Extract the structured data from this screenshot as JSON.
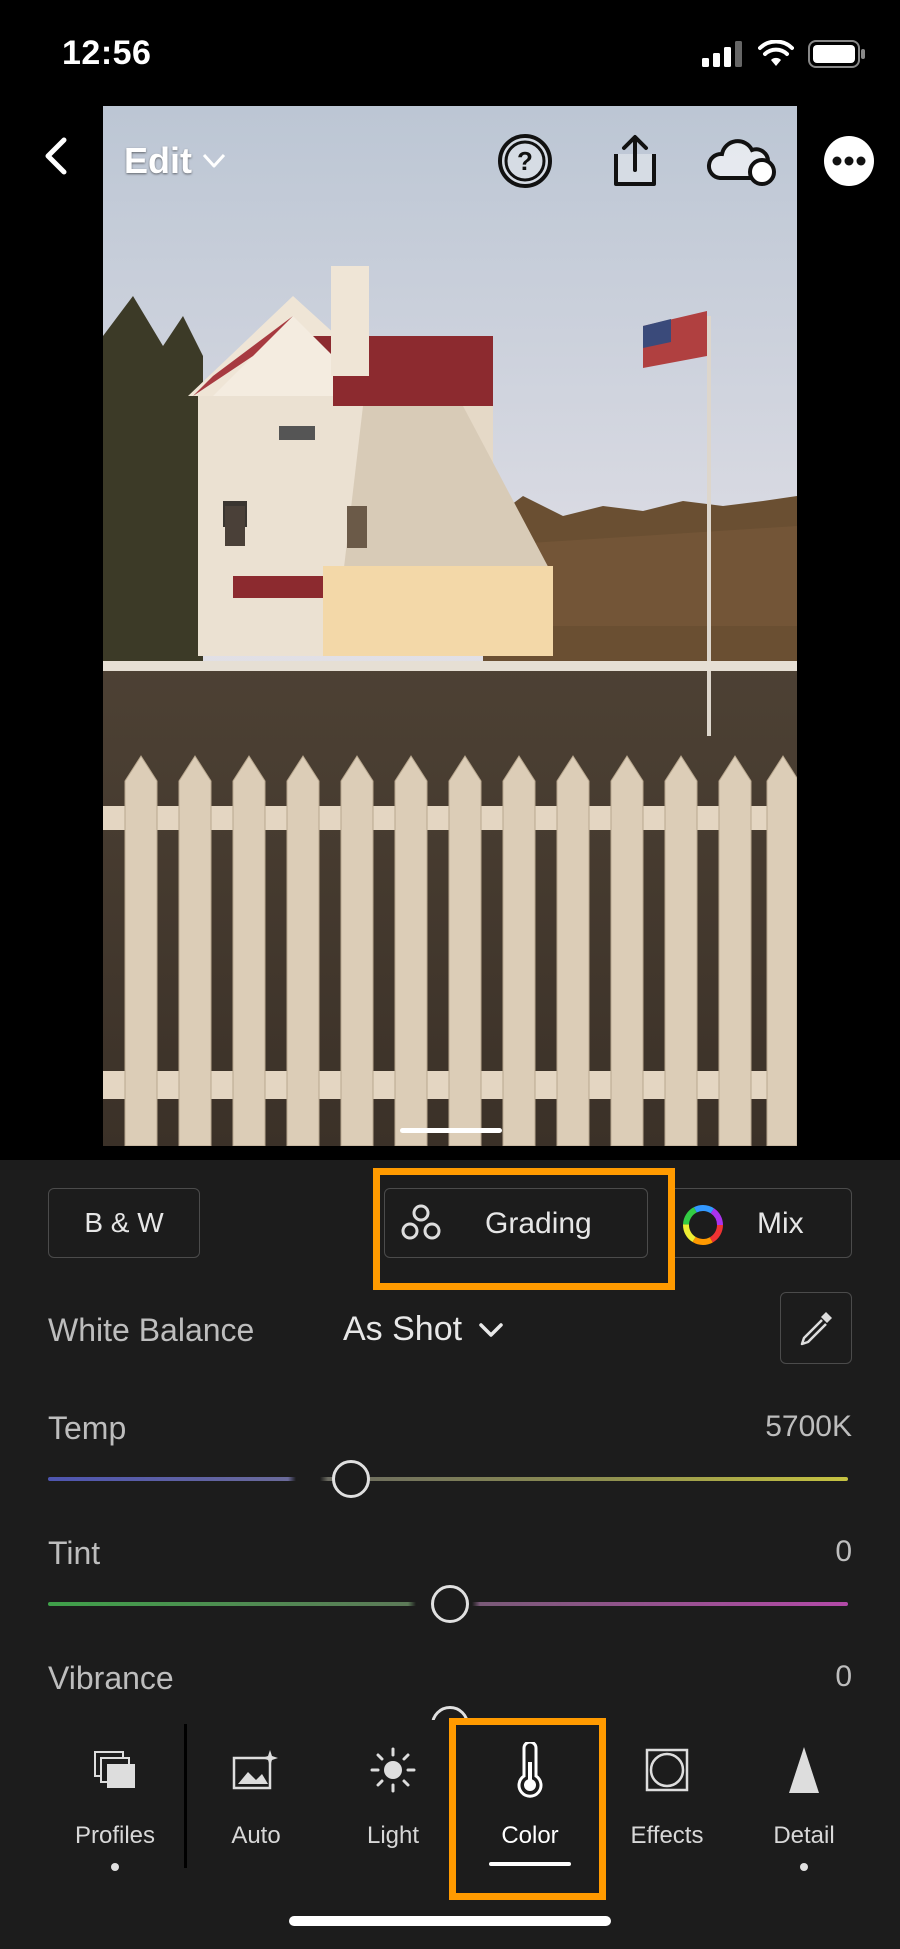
{
  "status_bar": {
    "time": "12:56"
  },
  "toolbar": {
    "edit_label": "Edit"
  },
  "color_panel": {
    "bw_button": "B & W",
    "grading_button": "Grading",
    "mix_button": "Mix",
    "white_balance_label": "White Balance",
    "white_balance_value": "As Shot",
    "sliders": [
      {
        "label": "Temp",
        "value": "5700K",
        "position": 0.38
      },
      {
        "label": "Tint",
        "value": "0",
        "position": 0.5
      },
      {
        "label": "Vibrance",
        "value": "0",
        "position": 0.5
      }
    ]
  },
  "tabs": [
    {
      "label": "Profiles",
      "icon": "profiles-icon"
    },
    {
      "label": "Auto",
      "icon": "auto-icon"
    },
    {
      "label": "Light",
      "icon": "sun-icon"
    },
    {
      "label": "Color",
      "icon": "thermometer-icon",
      "active": true
    },
    {
      "label": "Effects",
      "icon": "effects-icon"
    },
    {
      "label": "Detail",
      "icon": "detail-icon"
    }
  ],
  "colors": {
    "highlight": "#ff9a00",
    "panel_bg": "#1c1c1c"
  }
}
